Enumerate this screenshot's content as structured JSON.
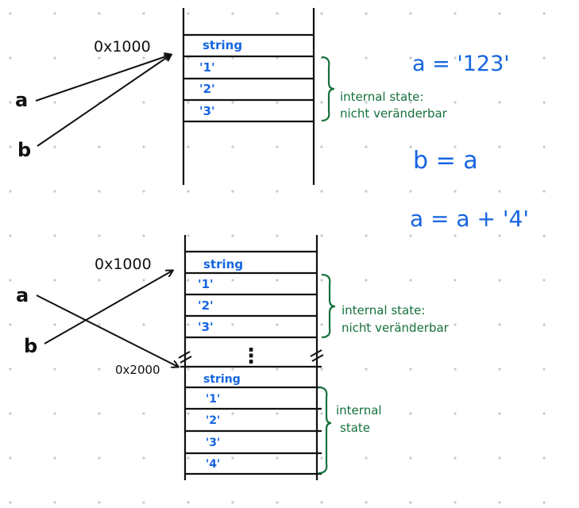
{
  "colors": {
    "ink": "#111111",
    "blue": "#1565e0",
    "green": "#14703c",
    "dot": "#c9c9c9"
  },
  "top": {
    "address": "0x1000",
    "var_a": "a",
    "var_b": "b",
    "header": "string",
    "cells": [
      "'1'",
      "'2'",
      "'3'"
    ],
    "brace_note_line1": "internal state:",
    "brace_note_line2": "nicht veränderbar"
  },
  "equations": {
    "eq1": "a = '123'",
    "eq2": "b = a",
    "eq3": "a = a + '4'"
  },
  "bottom": {
    "address1": "0x1000",
    "address2": "0x2000",
    "var_a": "a",
    "var_b": "b",
    "header1": "string",
    "cells1": [
      "'1'",
      "'2'",
      "'3'"
    ],
    "brace_note_line1": "internal state:",
    "brace_note_line2": "nicht veränderbar",
    "ellipsis": "⋮",
    "header2": "string",
    "cells2": [
      "'1'",
      "'2'",
      "'3'",
      "'4'"
    ],
    "brace2_note_line1": "internal",
    "brace2_note_line2": "state"
  }
}
